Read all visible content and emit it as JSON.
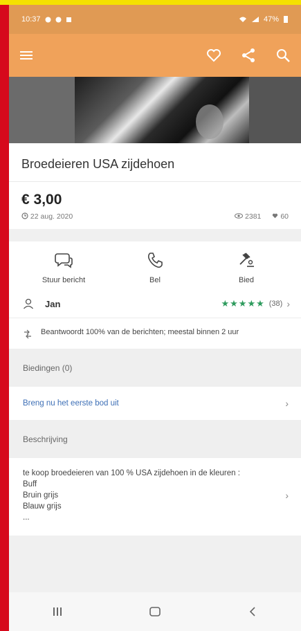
{
  "status_bar": {
    "time": "10:37",
    "right_text": "47%"
  },
  "listing": {
    "title": "Broedeieren USA zijdehoen",
    "price": "€ 3,00",
    "date": "22 aug. 2020",
    "views": "2381",
    "favorites": "60"
  },
  "contact": {
    "message_label": "Stuur bericht",
    "call_label": "Bel",
    "bid_label": "Bied"
  },
  "seller": {
    "name": "Jan",
    "stars": "★★★★★",
    "review_count": "(38)",
    "response": "Beantwoordt 100% van de berichten; meestal binnen 2 uur"
  },
  "bids": {
    "header": "Biedingen (0)",
    "cta": "Breng nu het eerste bod uit"
  },
  "description": {
    "header": "Beschrijving",
    "lines": [
      "te koop broedeieren van 100 % USA zijdehoen in de kleuren :",
      "Buff",
      "Bruin grijs",
      "Blauw grijs",
      "..."
    ]
  },
  "colors": {
    "status_bar": "#e09a54",
    "toolbar": "#f0a25a",
    "rating_green": "#2e9b5d",
    "link_blue": "#3d6fb6"
  }
}
